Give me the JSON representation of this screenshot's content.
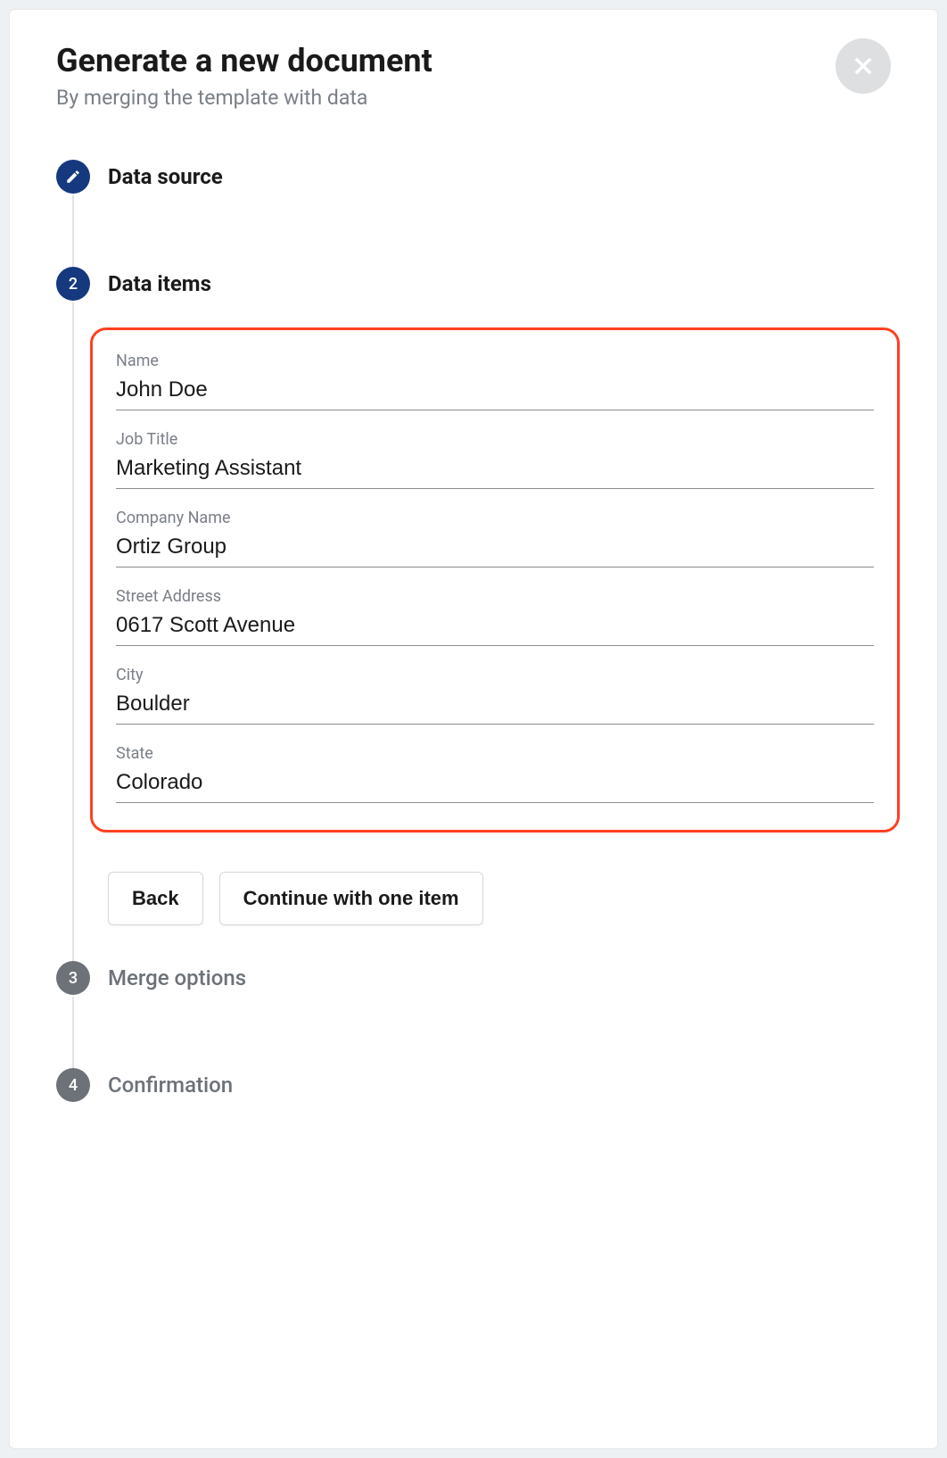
{
  "header": {
    "title": "Generate a new document",
    "subtitle": "By merging the template with data"
  },
  "steps": [
    {
      "label": "Data source",
      "bullet_icon": "pencil",
      "active": true
    },
    {
      "label": "Data items",
      "bullet_text": "2",
      "active": true
    },
    {
      "label": "Merge options",
      "bullet_text": "3",
      "active": false
    },
    {
      "label": "Confirmation",
      "bullet_text": "4",
      "active": false
    }
  ],
  "form": {
    "fields": [
      {
        "label": "Name",
        "value": "John Doe"
      },
      {
        "label": "Job Title",
        "value": "Marketing Assistant"
      },
      {
        "label": "Company Name",
        "value": "Ortiz Group"
      },
      {
        "label": "Street Address",
        "value": "0617 Scott Avenue"
      },
      {
        "label": "City",
        "value": "Boulder"
      },
      {
        "label": "State",
        "value": "Colorado"
      }
    ]
  },
  "buttons": {
    "back": "Back",
    "continue": "Continue with one item"
  }
}
